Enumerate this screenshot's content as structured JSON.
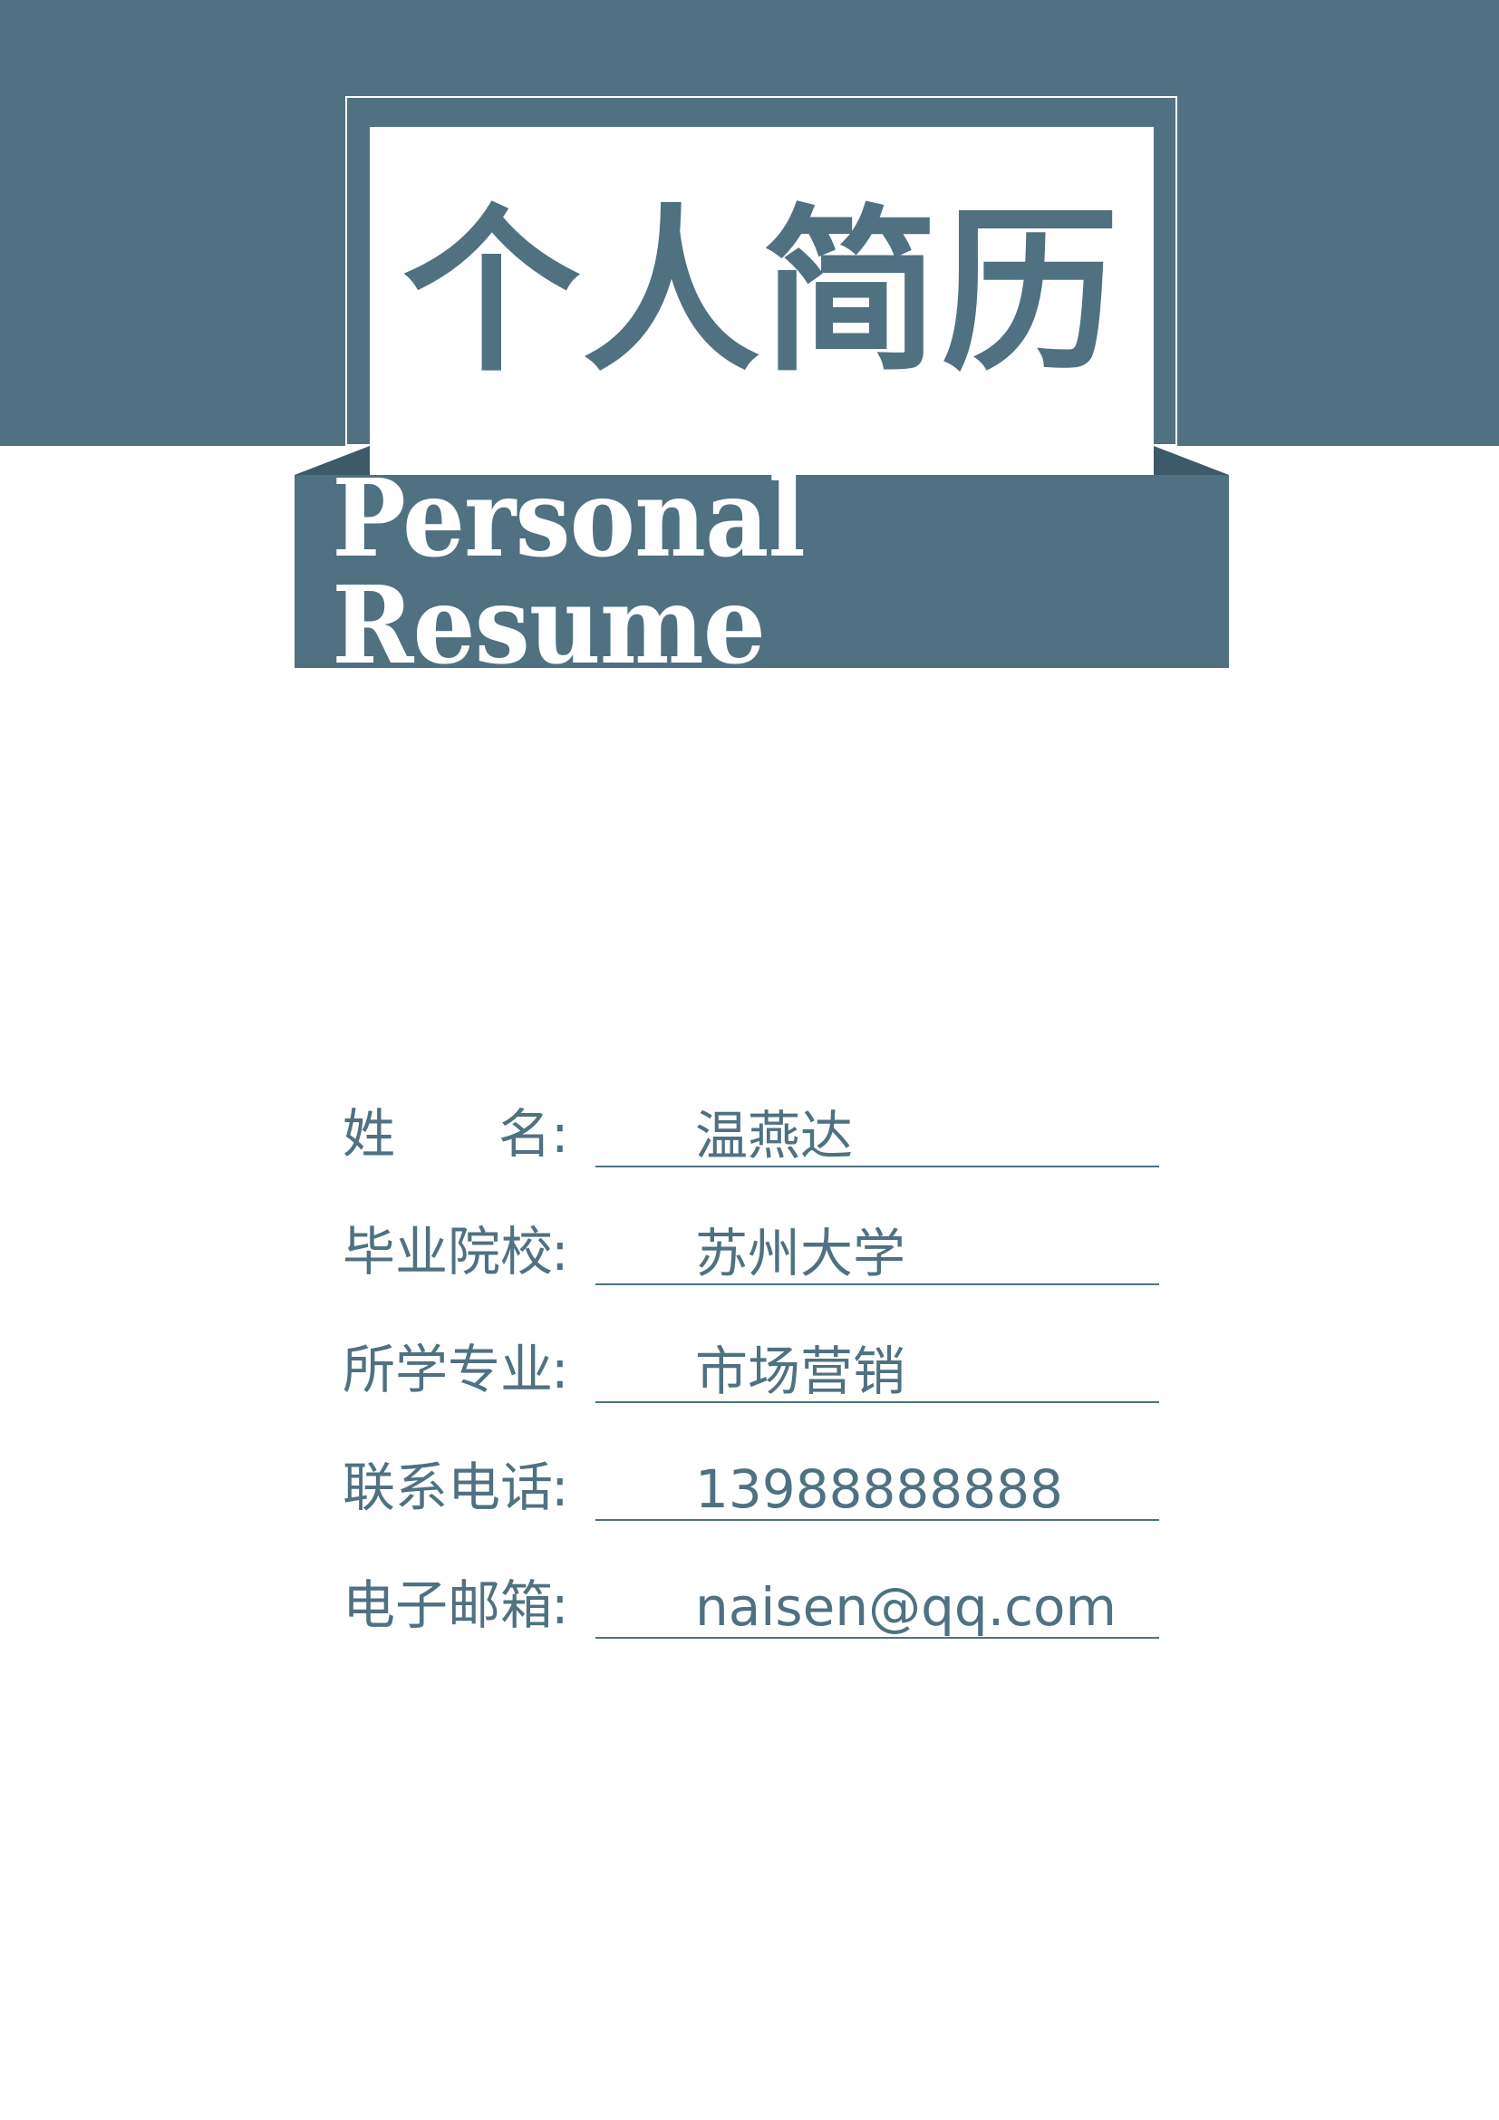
{
  "header": {
    "title": "个人简历",
    "subtitle": "Personal Resume"
  },
  "colors": {
    "accent": "#4f7182",
    "background": "#ffffff"
  },
  "info": {
    "rows": [
      {
        "label_left": "姓",
        "label_right": "名",
        "colon": ":",
        "value": "温燕达"
      },
      {
        "label": "毕业院校",
        "colon": ":",
        "value": "苏州大学"
      },
      {
        "label": "所学专业",
        "colon": ":",
        "value": "市场营销"
      },
      {
        "label": "联系电话",
        "colon": ":",
        "value": "13988888888"
      },
      {
        "label": "电子邮箱",
        "colon": ":",
        "value": "naisen@qq.com"
      }
    ]
  }
}
